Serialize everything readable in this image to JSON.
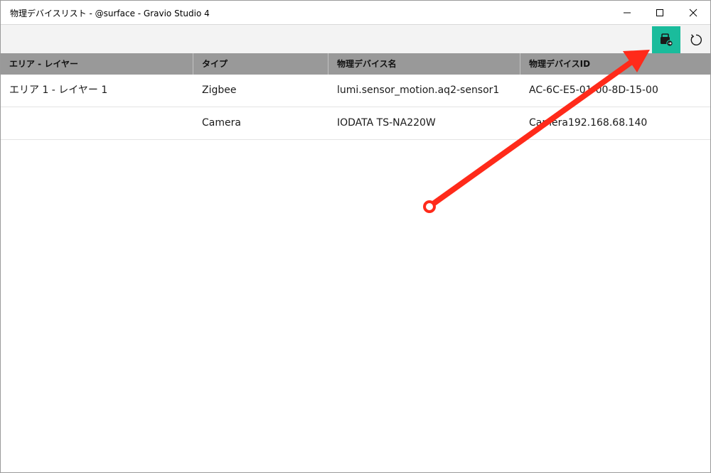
{
  "window": {
    "title": "物理デバイスリスト - @surface - Gravio Studio 4",
    "controls": {
      "minimize_icon": "minimize-icon",
      "maximize_icon": "maximize-icon",
      "close_icon": "close-icon"
    }
  },
  "toolbar": {
    "buttons": [
      {
        "name": "export-button",
        "icon": "export-icon",
        "accent": "#1abc9c"
      },
      {
        "name": "refresh-button",
        "icon": "refresh-icon"
      }
    ]
  },
  "table": {
    "columns": [
      "エリア - レイヤー",
      "タイプ",
      "物理デバイス名",
      "物理デバイスID"
    ],
    "rows": [
      {
        "area_layer": "エリア 1 - レイヤー 1",
        "type": "Zigbee",
        "device_name": "lumi.sensor_motion.aq2-sensor1",
        "device_id": "AC-6C-E5-01-00-8D-15-00"
      },
      {
        "area_layer": "",
        "type": "Camera",
        "device_name": "IODATA TS-NA220W",
        "device_id": "Camera192.168.68.140"
      }
    ]
  },
  "annotation": {
    "color": "#ff2a1a",
    "target": "export-button"
  }
}
